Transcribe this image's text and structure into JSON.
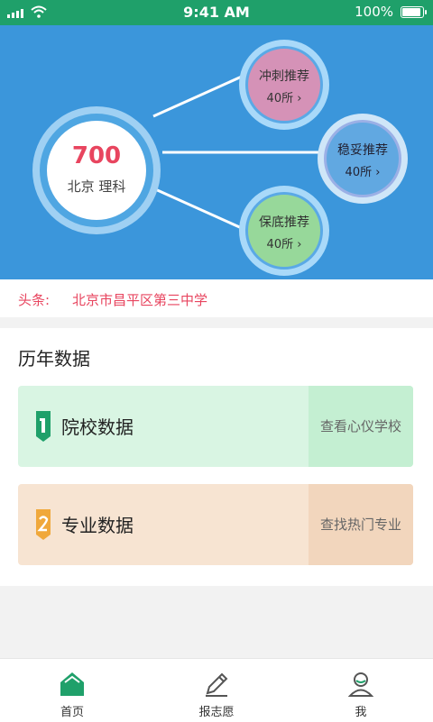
{
  "status_bar": {
    "time": "9:41 AM",
    "battery": "100%",
    "battery_level": 1.0
  },
  "hero": {
    "score": "700",
    "location": "北京 理科",
    "bubbles": [
      {
        "label": "冲刺推荐",
        "count": "40所",
        "color": "#d592b7"
      },
      {
        "label": "稳妥推荐",
        "count": "40所",
        "color": "#61a8e1"
      },
      {
        "label": "保底推荐",
        "count": "40所",
        "color": "#97d89a"
      }
    ]
  },
  "headline": {
    "label": "头条:",
    "text": "北京市昌平区第三中学"
  },
  "history": {
    "title": "历年数据",
    "cards": [
      {
        "name": "院校数据",
        "action": "查看心仪学校",
        "badge_color": "#1fa06a"
      },
      {
        "name": "专业数据",
        "action": "查找热门专业",
        "badge_color": "#f0a83b"
      }
    ]
  },
  "tabs": [
    {
      "label": "首页",
      "icon": "home-icon"
    },
    {
      "label": "报志愿",
      "icon": "pencil-icon"
    },
    {
      "label": "我",
      "icon": "profile-icon"
    }
  ],
  "colors": {
    "brand_green": "#1fa06a",
    "hero_blue": "#3b96db",
    "accent_red": "#e8455f"
  }
}
